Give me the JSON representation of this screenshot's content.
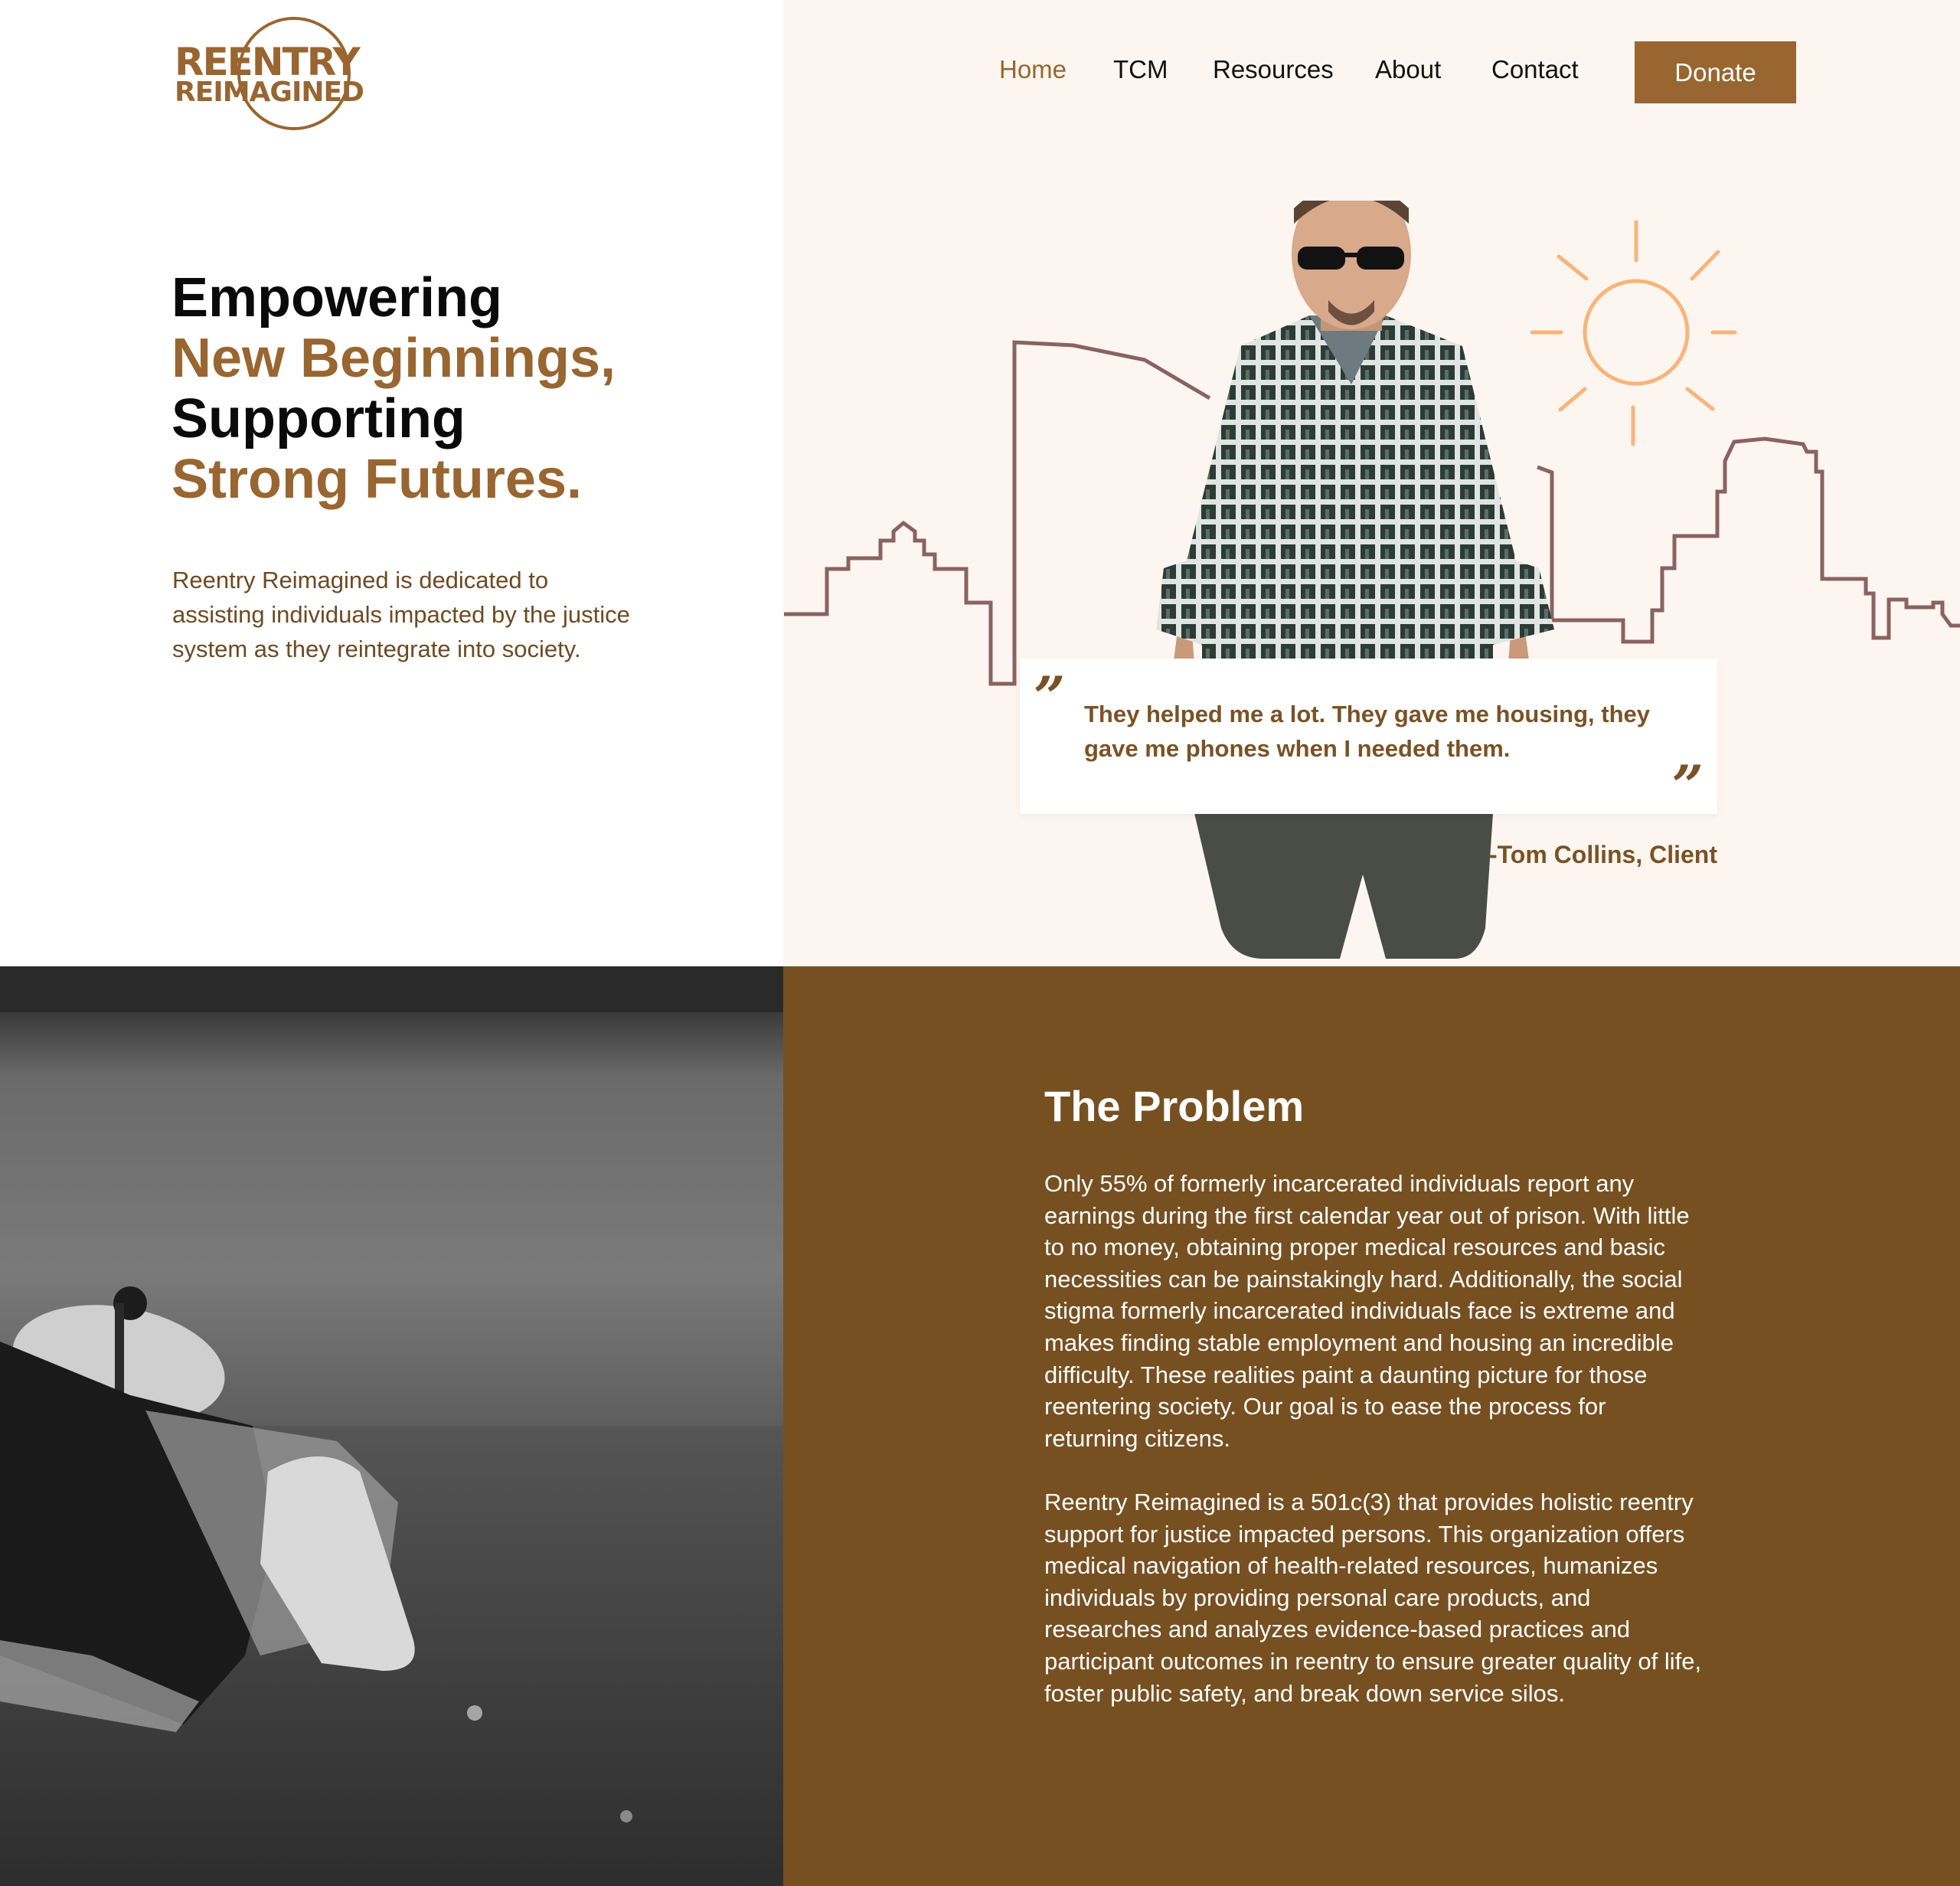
{
  "logo": {
    "line1": "REENTRY",
    "line2": "REIMAGINED"
  },
  "nav": {
    "items": [
      "Home",
      "TCM",
      "Resources",
      "About",
      "Contact"
    ],
    "active": "Home",
    "donate_label": "Donate"
  },
  "hero": {
    "headline": [
      "Empowering",
      "New Beginnings,",
      "Supporting",
      "Strong Futures."
    ],
    "intro": "Reentry Reimagined is dedicated to assisting individuals impacted by the justice system as they reintegrate into society."
  },
  "testimonial": {
    "open_mark": "”",
    "close_mark": "”",
    "quote": "They helped me a lot. They gave me housing, they gave me phones when I needed them.",
    "attribution": "-Tom Collins, Client"
  },
  "problem": {
    "title": "The Problem",
    "paragraph1": "Only 55% of formerly incarcerated individuals report any earnings during the first calendar year out of prison. With little to no money, obtaining proper medical resources and basic necessities can be painstakingly hard. Additionally, the social stigma formerly incarcerated individuals face is extreme and makes finding stable employment and housing an incredible difficulty. These realities paint a daunting picture for those reentering society. Our goal is to ease the process for returning citizens.",
    "paragraph2": "Reentry Reimagined is a 501c(3) that provides holistic reentry support for justice impacted persons. This organization offers medical navigation of health-related resources, humanizes individuals by providing personal care products, and researches and analyzes evidence-based practices and participant outcomes in reentry to ensure greater quality of life, foster public safety, and break down service silos."
  },
  "colors": {
    "brand_gold": "#996530",
    "brand_brown": "#775021",
    "hero_cream": "#fdf6f0",
    "sun_orange": "#f9b47a",
    "skyline": "#8a6262"
  },
  "icons": {
    "logo": "circle-logo-icon",
    "sun": "sun-illustration-icon",
    "skyline": "city-skyline-illustration",
    "quote": "quote-mark-icon"
  }
}
